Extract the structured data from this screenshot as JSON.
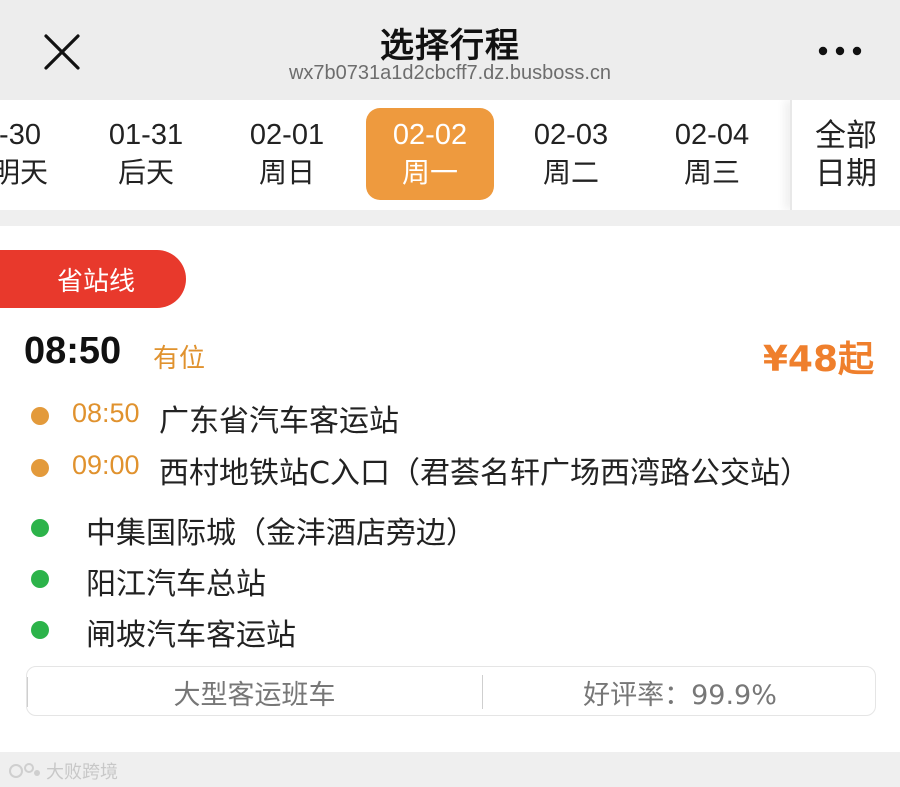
{
  "header": {
    "title": "选择行程",
    "url": "wx7b0731a1d2cbcff7.dz.busboss.cn",
    "close_icon": "close-icon",
    "more_icon": "more-dots-icon"
  },
  "date_strip": {
    "items": [
      {
        "date": "-30",
        "day": "明天"
      },
      {
        "date": "01-31",
        "day": "后天"
      },
      {
        "date": "02-01",
        "day": "周日"
      },
      {
        "date": "02-02",
        "day": "周一",
        "selected": true
      },
      {
        "date": "02-03",
        "day": "周二"
      },
      {
        "date": "02-04",
        "day": "周三"
      }
    ],
    "all_dates_line1": "全部",
    "all_dates_line2": "日期",
    "accent_color": "#ee9a3e"
  },
  "trip": {
    "route_tag": "省站线",
    "route_tag_color": "#e8392c",
    "departure_time": "08:50",
    "seat_status": "有位",
    "price": "¥48起",
    "price_color": "#ef7f2c",
    "boarding_stops": [
      {
        "time": "08:50",
        "name": "广东省汽车客运站"
      },
      {
        "time": "09:00",
        "name": "西村地铁站C入口（君荟名轩广场西湾路公交站）"
      }
    ],
    "alighting_stops": [
      {
        "name": "中集国际城（金沣酒店旁边）"
      },
      {
        "name": "阳江汽车总站"
      },
      {
        "name": "闸坡汽车客运站"
      }
    ],
    "boarding_dot_color": "#e39a3b",
    "alighting_dot_color": "#2cb34a",
    "bus_type": "大型客运班车",
    "rating": "好评率：99.9%"
  },
  "watermark": {
    "text": "大败跨境"
  }
}
